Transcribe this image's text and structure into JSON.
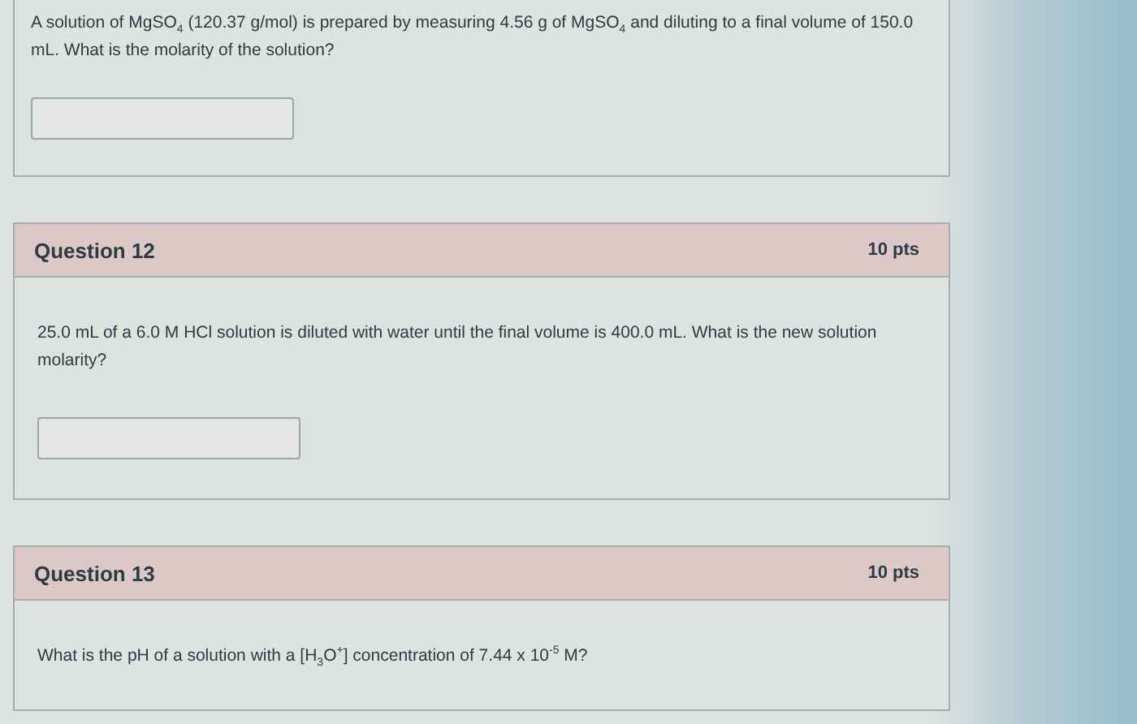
{
  "cards": [
    {
      "kind": "continued",
      "text": "A solution of MgSO$_{4}$ (120.37 g/mol) is prepared by measuring 4.56 g of MgSO$_{4}$ and diluting to a final volume of 150.0 mL. What is the molarity of the solution?",
      "answer_field": true
    },
    {
      "kind": "full",
      "title": "Question 12",
      "points": "10 pts",
      "text": "25.0 mL of a 6.0 M HCl solution is diluted with water until the final volume is 400.0 mL. What is the new solution molarity?",
      "answer_field": true
    },
    {
      "kind": "full",
      "title": "Question 13",
      "points": "10 pts",
      "text": "What is the pH of a solution with a [H$_{3}$O$^{+}$] concentration of 7.44 x 10$^{-5}$ M?",
      "answer_field": false
    }
  ]
}
